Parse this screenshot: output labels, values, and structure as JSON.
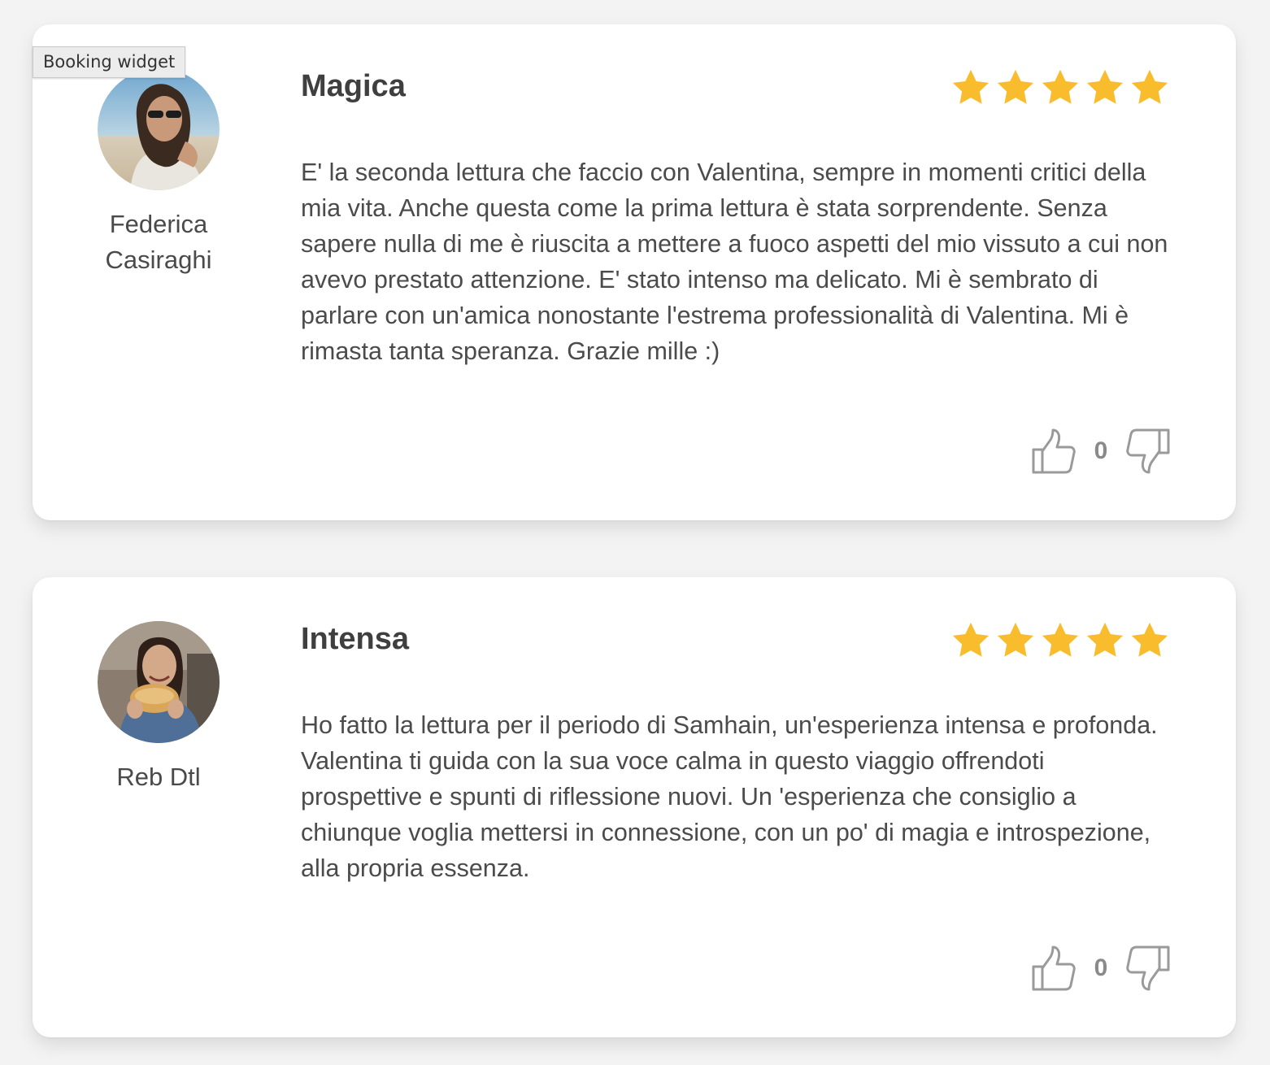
{
  "tooltip": "Booking widget",
  "colors": {
    "star": "#f9bc2c",
    "vote_icon": "#9a9a9a",
    "card_bg": "#ffffff",
    "page_bg": "#f3f3f3"
  },
  "reviews": [
    {
      "author": "Federica Casiraghi",
      "title": "Magica",
      "rating": 5,
      "text": "E' la seconda lettura che faccio con Valentina, sempre in momenti critici della mia vita. Anche questa come la prima lettura è stata sorprendente. Senza sapere nulla di me è riuscita a mettere a fuoco aspetti del mio vissuto a cui non avevo prestato attenzione. E' stato intenso ma delicato. Mi è sembrato di parlare con un'amica nonostante l'estrema professionalità di Valentina. Mi è rimasta tanta speranza. Grazie mille :)",
      "votes": "0",
      "icons": {
        "like": "thumbs-up-icon",
        "dislike": "thumbs-down-icon",
        "star": "star-icon"
      }
    },
    {
      "author": "Reb Dtl",
      "title": "Intensa",
      "rating": 5,
      "text": "Ho fatto la lettura per il periodo di Samhain, un'esperienza intensa e profonda. Valentina ti guida con la sua voce calma in questo viaggio offrendoti prospettive e spunti di riflessione nuovi. Un 'esperienza che consiglio a chiunque voglia mettersi in connessione, con un po' di magia e introspezione, alla propria essenza.",
      "votes": "0",
      "icons": {
        "like": "thumbs-up-icon",
        "dislike": "thumbs-down-icon",
        "star": "star-icon"
      }
    }
  ]
}
